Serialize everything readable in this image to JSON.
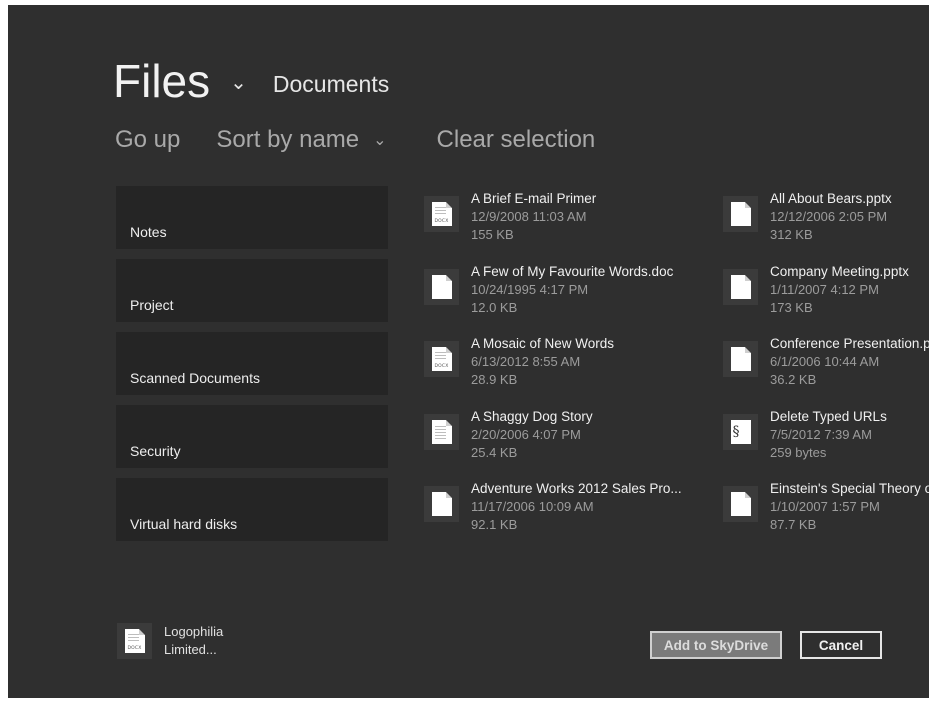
{
  "header": {
    "title": "Files",
    "location": "Documents"
  },
  "commands": {
    "go_up": "Go up",
    "sort": "Sort by name",
    "clear": "Clear selection"
  },
  "folders": [
    {
      "label": "Notes"
    },
    {
      "label": "Project"
    },
    {
      "label": "Scanned Documents"
    },
    {
      "label": "Security"
    },
    {
      "label": "Virtual hard disks"
    }
  ],
  "files_col1": [
    {
      "name": "A Brief E-mail Primer",
      "date": "12/9/2008 11:03 AM",
      "size": "155 KB",
      "icon": "docx-icon",
      "tag": "DOCX"
    },
    {
      "name": "A Few of My Favourite Words.doc",
      "date": "10/24/1995 4:17 PM",
      "size": "12.0 KB",
      "icon": "blank-document-icon"
    },
    {
      "name": "A Mosaic of New Words",
      "date": "6/13/2012 8:55 AM",
      "size": "28.9 KB",
      "icon": "docx-icon",
      "tag": "DOCX"
    },
    {
      "name": "A Shaggy Dog Story",
      "date": "2/20/2006 4:07 PM",
      "size": "25.4 KB",
      "icon": "text-document-icon"
    },
    {
      "name": "Adventure Works 2012 Sales Pro...",
      "date": "11/17/2006 10:09 AM",
      "size": "92.1 KB",
      "icon": "blank-document-icon"
    }
  ],
  "files_col2": [
    {
      "name": "All About Bears.pptx",
      "date": "12/12/2006 2:05 PM",
      "size": "312 KB",
      "icon": "blank-document-icon"
    },
    {
      "name": "Company Meeting.pptx",
      "date": "1/11/2007 4:12 PM",
      "size": "173 KB",
      "icon": "blank-document-icon"
    },
    {
      "name": "Conference Presentation.pptx",
      "date": "6/1/2006 10:44 AM",
      "size": "36.2 KB",
      "icon": "blank-document-icon"
    },
    {
      "name": "Delete Typed URLs",
      "date": "7/5/2012 7:39 AM",
      "size": "259 bytes",
      "icon": "script-icon"
    },
    {
      "name": "Einstein's Special Theory of Relativity",
      "date": "1/10/2007 1:57 PM",
      "size": "87.7 KB",
      "icon": "blank-document-icon"
    }
  ],
  "selection": {
    "name": "Logophilia Limited...",
    "tag": "DOCX"
  },
  "buttons": {
    "primary": "Add to SkyDrive",
    "cancel": "Cancel"
  }
}
